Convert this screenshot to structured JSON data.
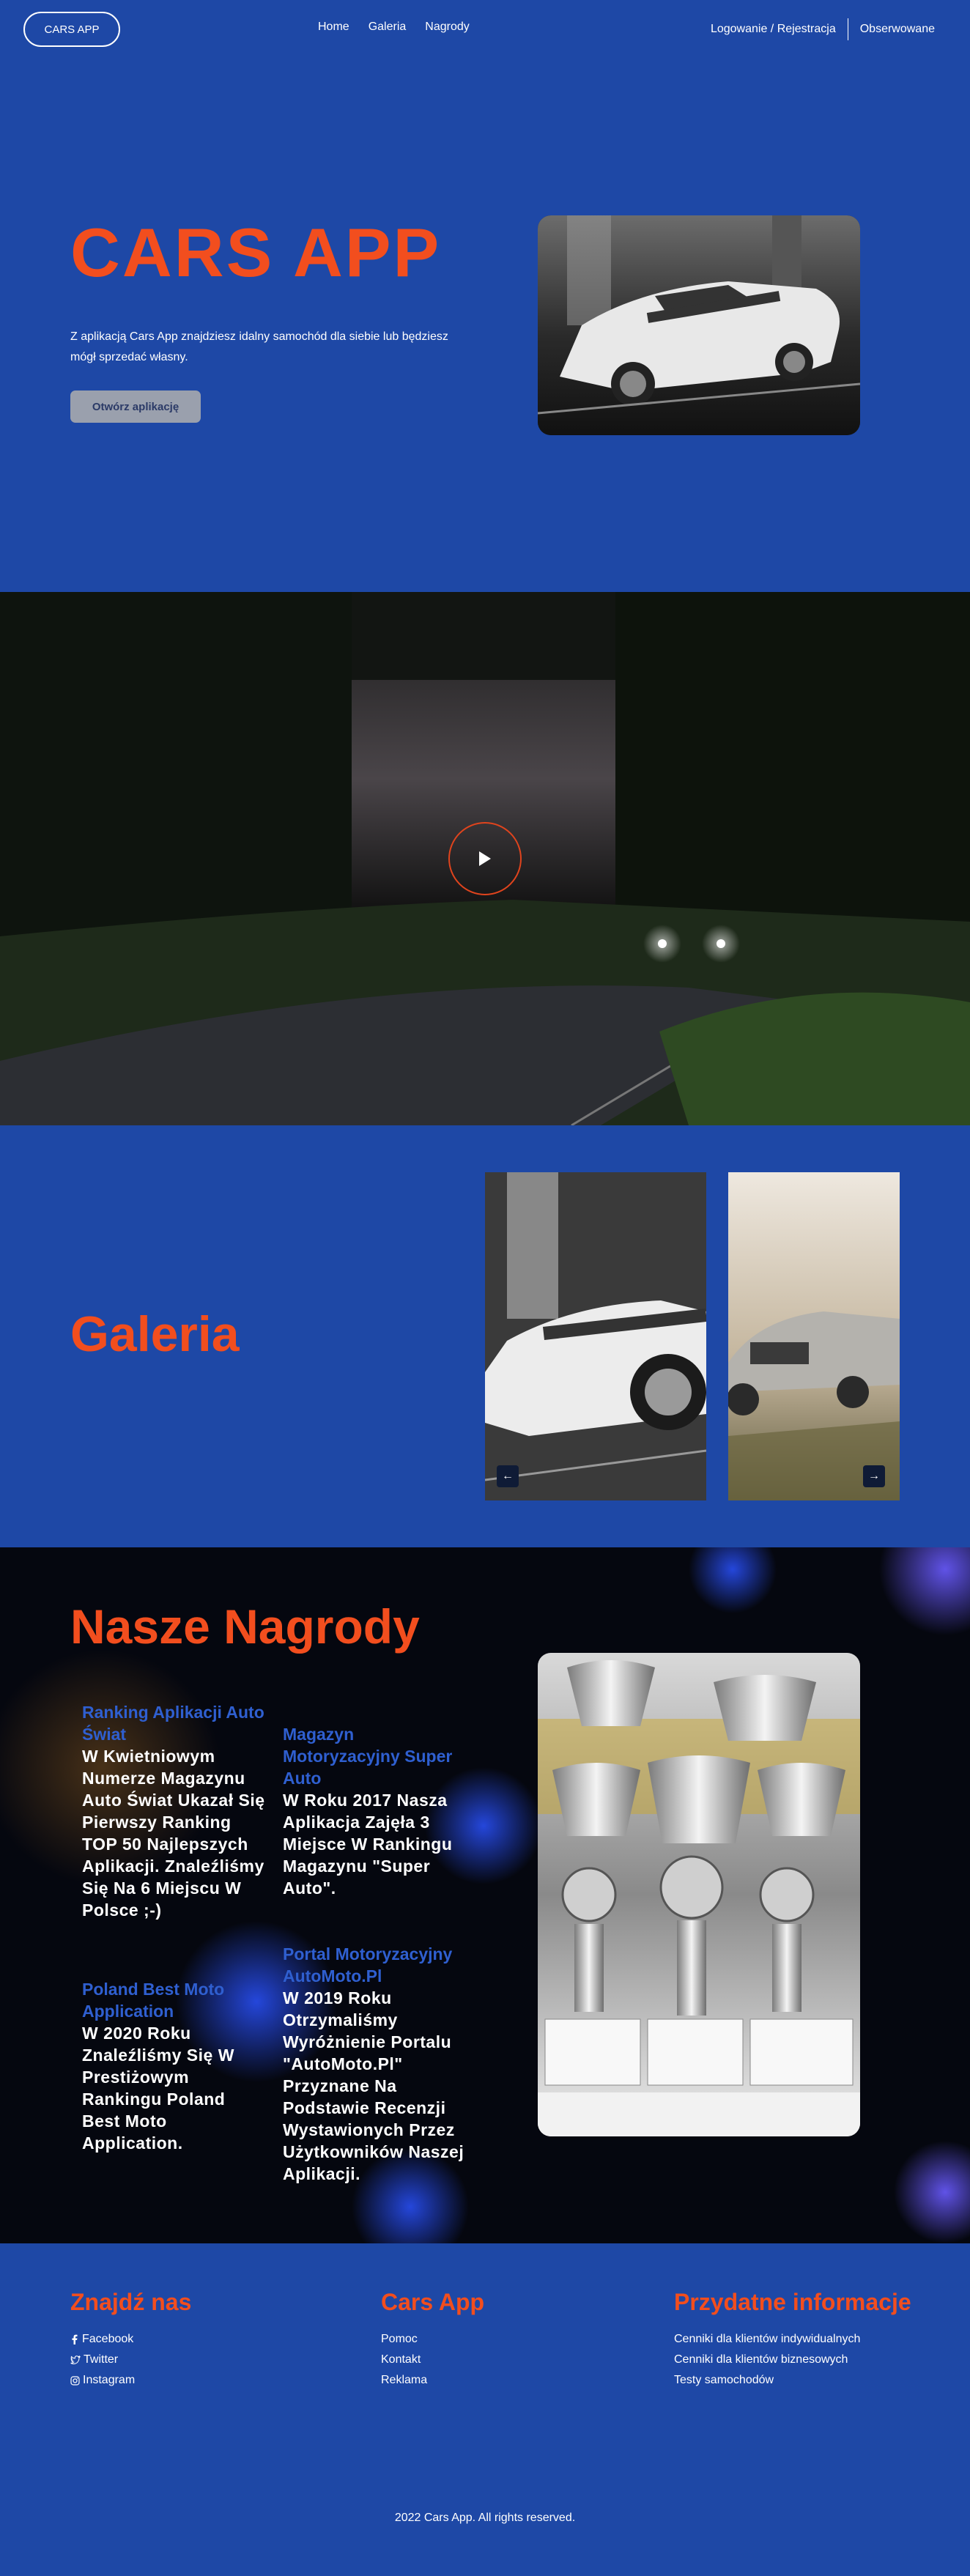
{
  "nav": {
    "brand": "CARS APP",
    "links": [
      "Home",
      "Galeria",
      "Nagrody"
    ],
    "login": "Logowanie / Rejestracja",
    "watched": "Obserwowane"
  },
  "hero": {
    "title": "CARS APP",
    "description": "Z aplikacją Cars App znajdziesz idalny samochód dla siebie lub będziesz mógł sprzedać własny.",
    "button": "Otwórz aplikację"
  },
  "gallery": {
    "title": "Galeria",
    "prev_icon": "arrow-left-icon",
    "next_icon": "arrow-right-icon"
  },
  "awards": {
    "title": "Nasze Nagrody",
    "items": [
      {
        "heading": "Ranking Aplikacji Auto Świat",
        "body": "W Kwietniowym Numerze Magazynu Auto Świat Ukazał Się Pierwszy Ranking TOP 50 Najlepszych Aplikacji. Znaleźliśmy Się Na 6 Miejscu W Polsce ;-)"
      },
      {
        "heading": "Magazyn Motoryzacyjny Super Auto",
        "body": "W Roku 2017 Nasza Aplikacja Zajęła 3 Miejsce W Rankingu Magazynu \"Super Auto\"."
      },
      {
        "heading": "Poland Best Moto Application",
        "body": "W 2020 Roku Znaleźliśmy Się W Prestiżowym Rankingu Poland Best Moto Application."
      },
      {
        "heading": "Portal Motoryzacyjny AutoMoto.Pl",
        "body": "W 2019 Roku Otrzymaliśmy Wyróżnienie Portalu \"AutoMoto.Pl\" Przyznane Na Podstawie Recenzji Wystawionych Przez Użytkowników Naszej Aplikacji."
      }
    ]
  },
  "footer": {
    "col1": {
      "title": "Znajdź nas",
      "links": [
        "Facebook",
        "Twitter",
        "Instagram"
      ]
    },
    "col2": {
      "title": "Cars App",
      "links": [
        "Pomoc",
        "Kontakt",
        "Reklama"
      ]
    },
    "col3": {
      "title": "Przydatne informacje",
      "links": [
        "Cenniki dla klientów indywidualnych",
        "Cenniki dla klientów biznesowych",
        "Testy samochodów"
      ]
    },
    "copyright": "2022 Cars App. All rights reserved."
  },
  "colors": {
    "accent": "#f24e1e",
    "background": "#1e48a6",
    "award_heading": "#2f5fd0"
  }
}
